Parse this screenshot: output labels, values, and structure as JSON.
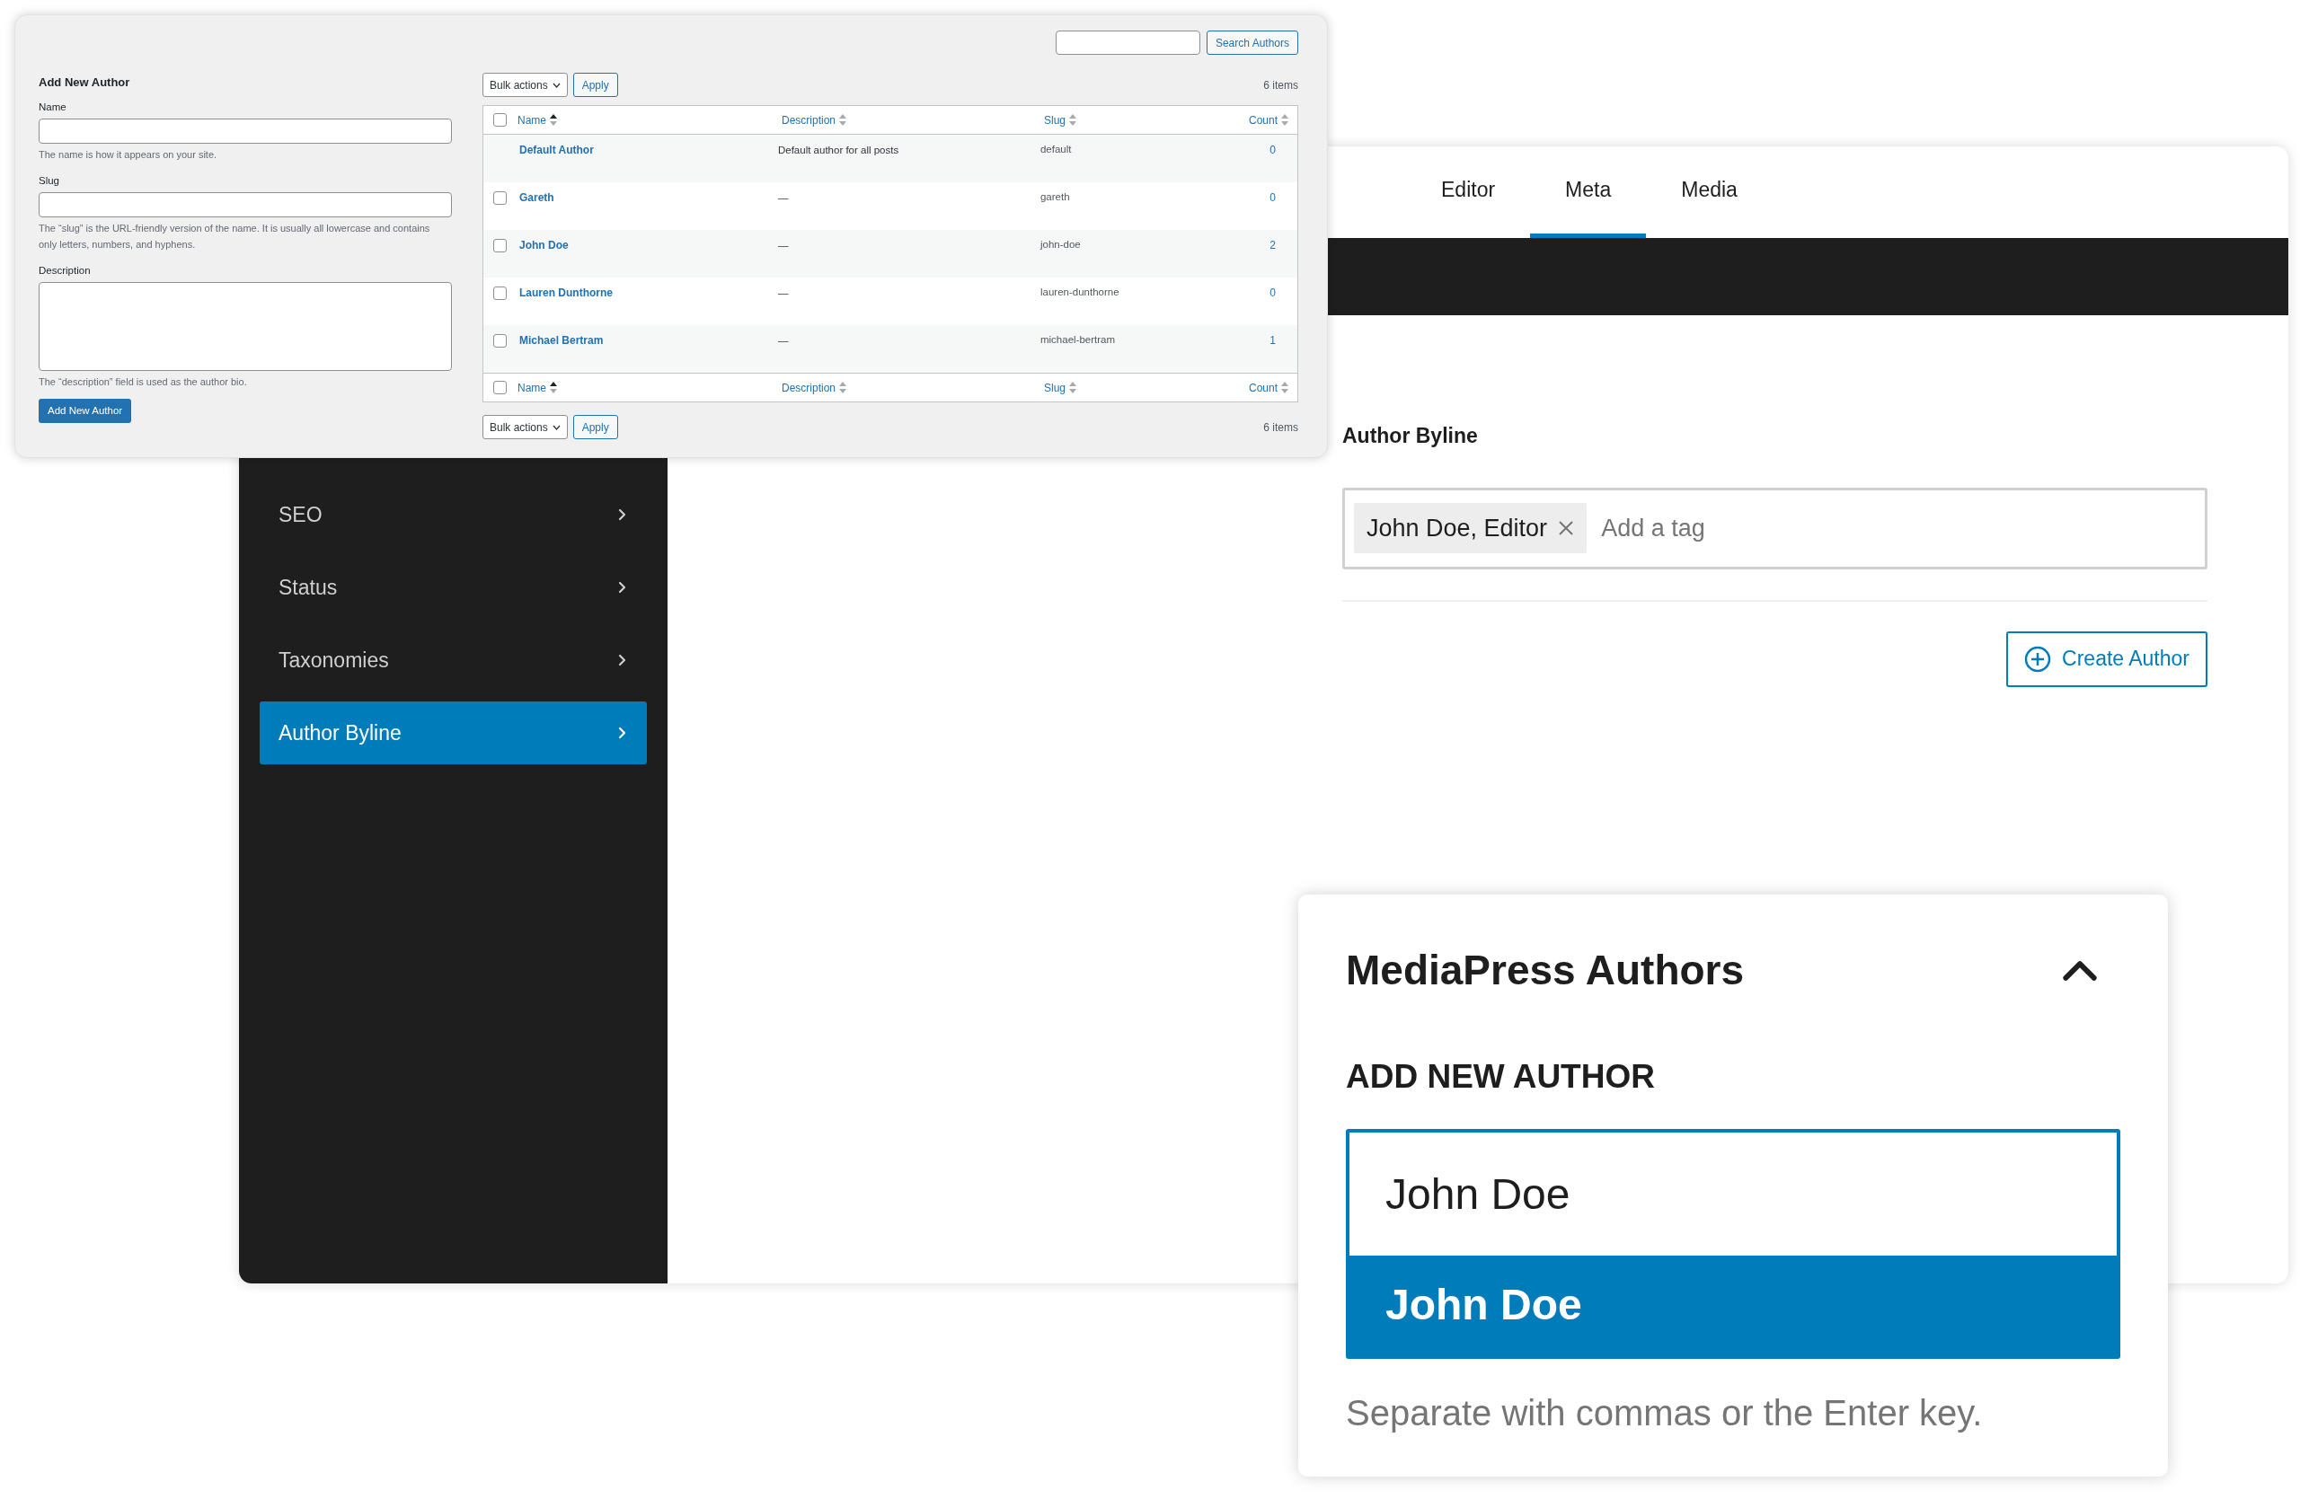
{
  "authors_admin": {
    "form": {
      "heading": "Add New Author",
      "fields": [
        {
          "kind": "input",
          "label": "Name",
          "hint": "The name is how it appears on your site."
        },
        {
          "kind": "input",
          "label": "Slug",
          "hint": "The “slug” is the URL-friendly version of the name. It is usually all lowercase and contains only letters, numbers, and hyphens."
        },
        {
          "kind": "textarea",
          "label": "Description",
          "hint": "The “description” field is used as the author bio."
        }
      ],
      "submit": "Add New Author"
    },
    "search_button": "Search Authors",
    "top_actions": {
      "bulk": "Bulk actions",
      "apply": "Apply",
      "count": "6 items"
    },
    "header_checked": false,
    "footer_checked": false,
    "columns": [
      {
        "label": "Name",
        "sorted": true
      },
      {
        "label": "Description",
        "sorted": false
      },
      {
        "label": "Slug",
        "sorted": false
      },
      {
        "label": "Count",
        "sorted": false
      }
    ],
    "rows": [
      {
        "name": "Default Author",
        "description": "Default author for all posts",
        "slug": "default",
        "count": "0",
        "selectable": false
      },
      {
        "name": "Gareth",
        "description": "—",
        "slug": "gareth",
        "count": "0",
        "selectable": true,
        "checked": false
      },
      {
        "name": "John Doe",
        "description": "—",
        "slug": "john-doe",
        "count": "2",
        "selectable": true,
        "checked": false
      },
      {
        "name": "Lauren Dunthorne",
        "description": "—",
        "slug": "lauren-dunthorne",
        "count": "0",
        "selectable": true,
        "checked": false
      },
      {
        "name": "Michael Bertram",
        "description": "—",
        "slug": "michael-bertram",
        "count": "1",
        "selectable": true,
        "checked": false
      }
    ],
    "footer_columns": [
      {
        "label": "Name",
        "sorted": true
      },
      {
        "label": "Description",
        "sorted": false
      },
      {
        "label": "Slug",
        "sorted": false
      },
      {
        "label": "Count",
        "sorted": false
      }
    ],
    "bottom_actions": {
      "bulk": "Bulk actions",
      "apply": "Apply",
      "count": "6 items"
    }
  },
  "editor": {
    "tabs": [
      {
        "label": "Editor",
        "selected": false
      },
      {
        "label": "Meta",
        "selected": true
      },
      {
        "label": "Media",
        "selected": false
      }
    ],
    "sidebar": {
      "items": [
        {
          "label": "SEO",
          "selected": false
        },
        {
          "label": "Status",
          "selected": false
        },
        {
          "label": "Taxonomies",
          "selected": false
        },
        {
          "label": "Author Byline",
          "selected": true
        }
      ]
    },
    "byline": {
      "label": "Author Byline",
      "tags": [
        "John Doe, Editor"
      ],
      "placeholder": "Add a tag"
    },
    "create_button": "Create Author"
  },
  "authors_panel": {
    "title": "MediaPress Authors",
    "expanded": true,
    "section": "ADD NEW AUTHOR",
    "input_value": "John Doe",
    "suggestions": [
      {
        "label": "John Doe",
        "selected": true
      }
    ],
    "help": "Separate with commas or the Enter key."
  }
}
